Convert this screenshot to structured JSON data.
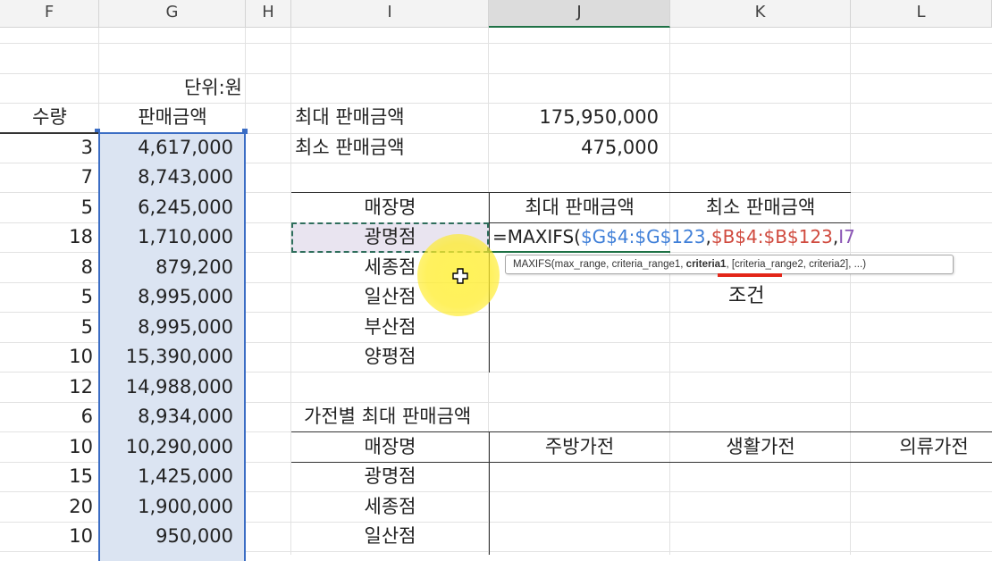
{
  "columns": [
    "F",
    "G",
    "H",
    "I",
    "J",
    "K",
    "L"
  ],
  "data_block": {
    "unit_label": "단위:원",
    "header_qty": "수량",
    "header_amount": "판매금액",
    "rows": [
      {
        "qty": "3",
        "amount": "4,617,000"
      },
      {
        "qty": "7",
        "amount": "8,743,000"
      },
      {
        "qty": "5",
        "amount": "6,245,000"
      },
      {
        "qty": "18",
        "amount": "1,710,000"
      },
      {
        "qty": "8",
        "amount": "879,200"
      },
      {
        "qty": "5",
        "amount": "8,995,000"
      },
      {
        "qty": "5",
        "amount": "8,995,000"
      },
      {
        "qty": "10",
        "amount": "15,390,000"
      },
      {
        "qty": "12",
        "amount": "14,988,000"
      },
      {
        "qty": "6",
        "amount": "8,934,000"
      },
      {
        "qty": "10",
        "amount": "10,290,000"
      },
      {
        "qty": "15",
        "amount": "1,425,000"
      },
      {
        "qty": "20",
        "amount": "1,900,000"
      },
      {
        "qty": "10",
        "amount": "950,000"
      }
    ]
  },
  "summary": {
    "max_label": "최대 판매금액",
    "max_value": "175,950,000",
    "min_label": "최소 판매금액",
    "min_value": "475,000"
  },
  "store_table": {
    "header_store": "매장명",
    "header_max": "최대 판매금액",
    "header_min": "최소 판매금액",
    "stores": [
      "광명점",
      "세종점",
      "일산점",
      "부산점",
      "양평점"
    ]
  },
  "formula": {
    "prefix": "=MAXIFS(",
    "arg1": "$G$4:$G$123",
    "sep1": ",",
    "arg2": "$B$4:$B$123",
    "sep2": ",",
    "arg3": "I7",
    "tooltip_fn": "MAXIFS(max_range, criteria_range1, ",
    "tooltip_bold": "criteria1",
    "tooltip_rest": ", [criteria_range2, criteria2], ...)",
    "annotation": "조건",
    "colors": {
      "arg1": "#3f7fd8",
      "arg2": "#d04a3e",
      "arg3": "#8a55b5",
      "annotation_underline": "#e32619"
    }
  },
  "appliance_table": {
    "title": "가전별 최대 판매금액",
    "header_store": "매장명",
    "header_kitchen": "주방가전",
    "header_living": "생활가전",
    "header_clothing": "의류가전",
    "stores": [
      "광명점",
      "세종점",
      "일산점"
    ]
  }
}
